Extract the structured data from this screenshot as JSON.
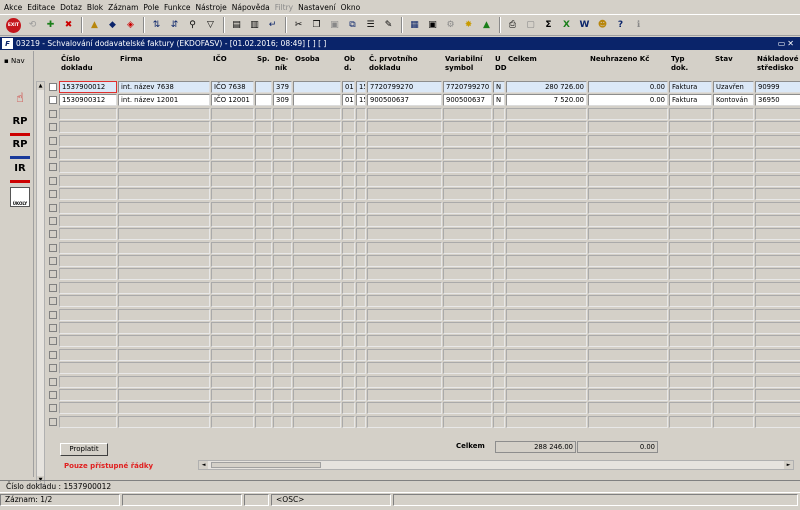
{
  "menu": [
    "Akce",
    "Editace",
    "Dotaz",
    "Blok",
    "Záznam",
    "Pole",
    "Funkce",
    "Nástroje",
    "Nápověda",
    "Filtry",
    "Nastavení",
    "Okno"
  ],
  "exit_label": "EXIT",
  "window": {
    "title": "03219 - Schvalování dodavatelské faktury (EKDOFASV) - [01.02.2016; 08:49]  [ ]  [ ]",
    "controls": "▭✕"
  },
  "nav": {
    "label": "Nav",
    "icons": [
      "RP",
      "RP",
      "IR",
      "ÚKOLY"
    ]
  },
  "columns": [
    "Číslo\ndokladu",
    "Firma",
    "IČO",
    "Sp.",
    "De-\nník",
    "Osoba",
    "Ob\nd.",
    "Č. prvotního\ndokladu",
    "Variabilní\nsymbol",
    "U\nDD",
    "Celkem",
    "Neuhrazeno Kč",
    "Typ\ndok.",
    "Stav",
    "Nákladové\nstředisko"
  ],
  "rows": [
    [
      "1537900012",
      "int. název 7638",
      "IČO 7638",
      "",
      "379",
      "",
      "01",
      "15",
      "7720799270",
      "7720799270",
      "N",
      "280 726.00",
      "0.00",
      "Faktura",
      "Uzavřen",
      "90999"
    ],
    [
      "1530900312",
      "int. název 12001",
      "IČO 12001",
      "",
      "309",
      "",
      "01",
      "15",
      "900500637",
      "900500637",
      "N",
      "7 520.00",
      "0.00",
      "Faktura",
      "Kontován",
      "36950"
    ]
  ],
  "footer": {
    "button": "Proplatit",
    "notice": "Pouze přístupné řádky",
    "total_label": "Celkem",
    "total_celkem": "288 246.00",
    "total_neuhrazeno": "0.00"
  },
  "status": {
    "line1": "Číslo dokladu : 1537900012",
    "record": "Záznam: 1/2",
    "mode": "<OSC>"
  }
}
